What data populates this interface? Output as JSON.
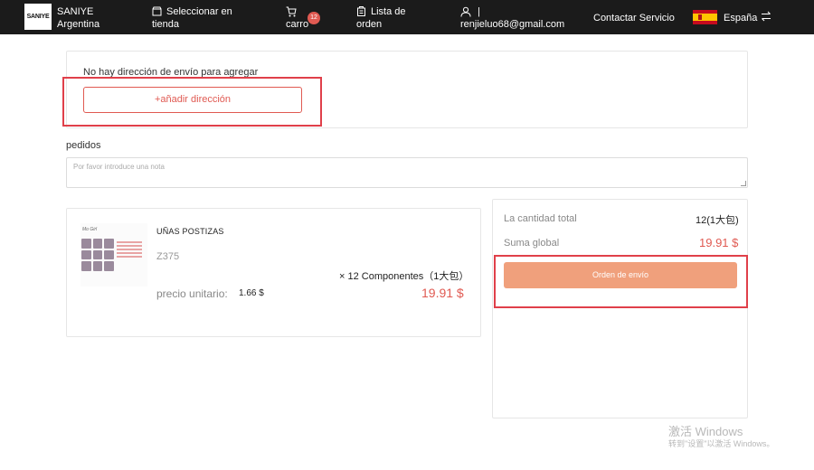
{
  "header": {
    "logo_text": "SANIYE",
    "brand_line1": "SANIYE",
    "brand_line2": "Argentina",
    "store_line1": "Seleccionar en",
    "store_line2": "tienda",
    "cart_label": "carro",
    "cart_count": "12",
    "orders_line1": "Lista de",
    "orders_line2": "orden",
    "user_line1": "|",
    "user_email": "renjieluo68@gmail.com",
    "contact_label": "Contactar Servicio",
    "language": "España",
    "icons": [
      "store-icon",
      "cart-icon",
      "orders-icon",
      "user-icon",
      "spain-flag-icon",
      "swap-icon"
    ]
  },
  "address": {
    "empty_message": "No hay dirección de envío para agregar",
    "add_button_label": "+añadir dirección"
  },
  "notes": {
    "label": "pedidos",
    "placeholder": "Por favor introduce una nota"
  },
  "product": {
    "name": "UÑAS POSTIZAS",
    "code": "Z375",
    "quantity_text": "× 12 Componentes（1大包）",
    "unit_price_label": "precio unitario:",
    "unit_price": "1.66 $",
    "total": "19.91 $",
    "thumbnail_title": "Mo Girl"
  },
  "summary": {
    "quantity_label": "La cantidad total",
    "quantity_value": "12(1大包)",
    "total_label": "Suma global",
    "total_value": "19.91 $",
    "order_button_label": "Orden de envío"
  },
  "watermark": {
    "line1": "激活 Windows",
    "line2": "转到\"设置\"以激活 Windows。"
  },
  "colors": {
    "header_bg": "#1b1b1b",
    "accent_red": "#e05a52",
    "order_button": "#f0a07c",
    "highlight_box": "#e0404a"
  }
}
